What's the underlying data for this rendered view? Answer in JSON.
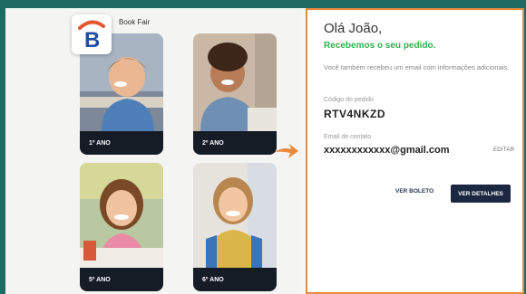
{
  "brand": {
    "name": "Book Fair",
    "logo_letter": "B",
    "accent_color": "#1f4fa3",
    "logo_swoosh_color": "#e4572e"
  },
  "grades": [
    {
      "label": "1º ANO"
    },
    {
      "label": "2º ANO"
    },
    {
      "label": "5º ANO"
    },
    {
      "label": "6º ANO"
    }
  ],
  "confirmation": {
    "greeting": "Olá João,",
    "received_message": "Recebemos o seu pedido.",
    "email_info": "Você também recebeu um email com informações adicionais.",
    "order_code_label": "Código do pedido",
    "order_code": "RTV4NKZD",
    "contact_email_label": "Email de contato",
    "contact_email": "xxxxxxxxxxxx@gmail.com",
    "edit_label": "EDITAR",
    "boleto_button": "VER BOLETO",
    "details_button": "VER DETALHES"
  },
  "colors": {
    "frame": "#1f6a63",
    "panel_border": "#e88a3c",
    "success": "#2fb34f",
    "primary_button": "#1c2741",
    "card_label_bg": "#151c26"
  },
  "icons": {
    "arrow": "arrow-right-icon"
  }
}
